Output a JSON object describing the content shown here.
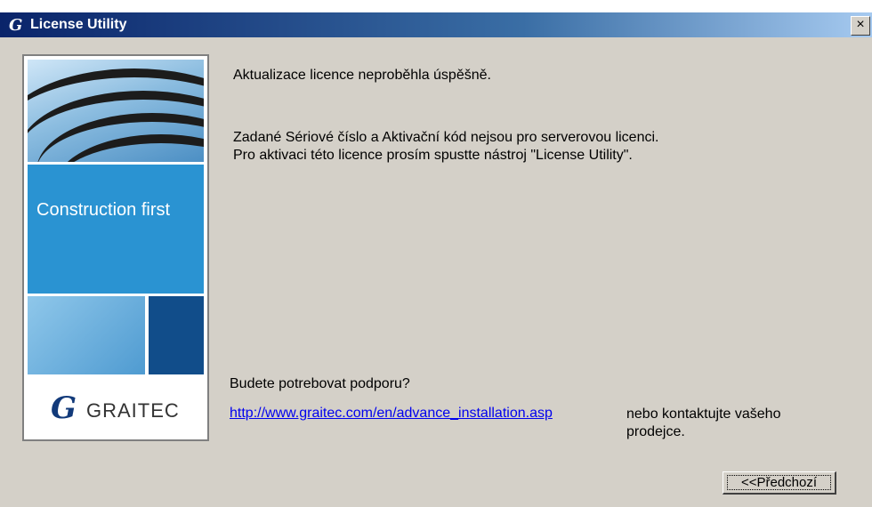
{
  "window": {
    "title": "License Utility",
    "app_icon": "graitec-g-icon",
    "close_label": "×"
  },
  "sidebar": {
    "banner_text": "Construction first",
    "logo_letter": "G",
    "logo_text": "GRAITEC"
  },
  "messages": {
    "status": "Aktualizace licence neproběhla úspěšně.",
    "line1": "Zadané Sériové číslo a Aktivační kód nejsou pro serverovou licenci.",
    "line2": "Pro aktivaci této licence prosím spustte nástroj \"License Utility\"."
  },
  "support": {
    "question": "Budete potrebovat podporu?",
    "link_text": "http://www.graitec.com/en/advance_installation.asp",
    "contact_text": "nebo kontaktujte vašeho prodejce."
  },
  "buttons": {
    "previous": "<<Předchozí"
  }
}
